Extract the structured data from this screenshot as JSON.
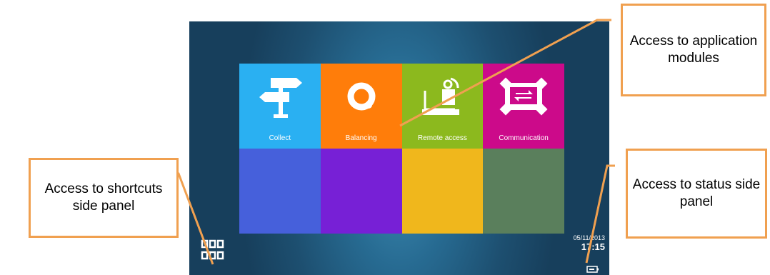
{
  "tiles": [
    {
      "label": "Collect",
      "color": "#2ab0f2",
      "icon": "signpost-icon"
    },
    {
      "label": "Balancing",
      "color": "#ff7d0a",
      "icon": "ring-icon"
    },
    {
      "label": "Remote access",
      "color": "#8cb91e",
      "icon": "router-icon"
    },
    {
      "label": "Communication",
      "color": "#cc0a8a",
      "icon": "transfer-icon"
    },
    {
      "label": "",
      "color": "#4660db",
      "icon": ""
    },
    {
      "label": "",
      "color": "#7720d6",
      "icon": ""
    },
    {
      "label": "",
      "color": "#f0b71c",
      "icon": ""
    },
    {
      "label": "",
      "color": "#5a7f5c",
      "icon": ""
    }
  ],
  "status": {
    "date": "05/11/2013",
    "time": "17:15",
    "icon": "battery-icon"
  },
  "shortcut_icon": "grid-icon",
  "callouts": {
    "app_modules": "Access to application modules",
    "shortcuts": "Access to shortcuts side panel",
    "status": "Access to status side panel"
  },
  "colors": {
    "callout_border": "#f0a050",
    "screen_bg": "#1d4f70"
  }
}
